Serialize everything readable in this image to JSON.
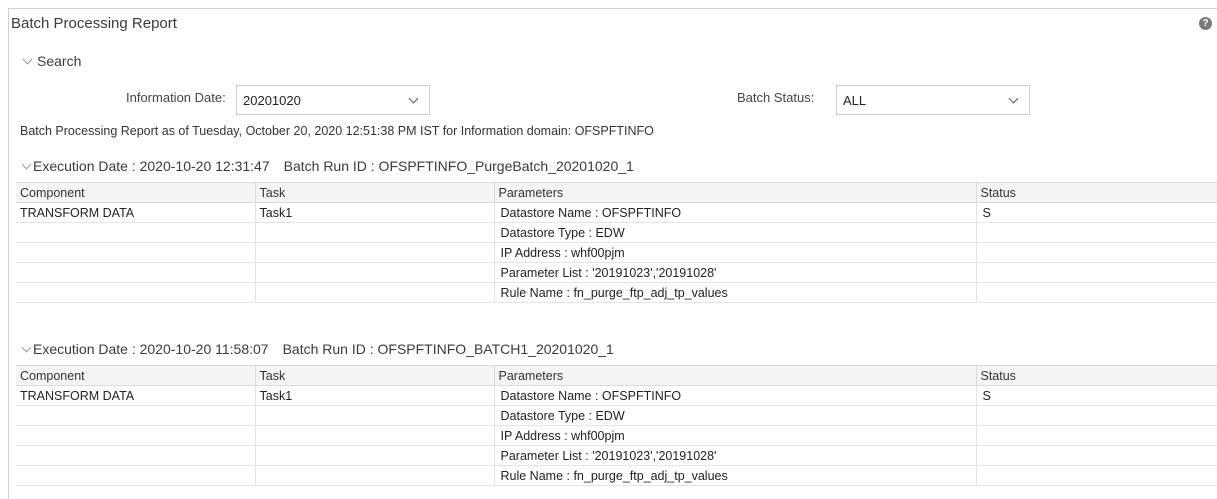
{
  "page": {
    "title": "Batch Processing Report",
    "help_icon": "?"
  },
  "search": {
    "label": "Search",
    "info_date_label": "Information Date:",
    "info_date_value": "20201020",
    "batch_status_label": "Batch Status:",
    "batch_status_value": "ALL"
  },
  "report_line": "Batch Processing Report as of Tuesday, October 20, 2020 12:51:38 PM IST for Information domain: OFSPFTINFO",
  "columns": [
    "Component",
    "Task",
    "Parameters",
    "Status"
  ],
  "executions": [
    {
      "execution_date": "Execution Date : 2020-10-20 12:31:47",
      "batch_run_id": "Batch Run ID : OFSPFTINFO_PurgeBatch_20201020_1",
      "rows": [
        {
          "component": "TRANSFORM DATA",
          "task": "Task1",
          "parameter": "Datastore Name : OFSPFTINFO",
          "status": "S"
        },
        {
          "component": "",
          "task": "",
          "parameter": "Datastore Type : EDW",
          "status": ""
        },
        {
          "component": "",
          "task": "",
          "parameter": "IP Address : whf00pjm",
          "status": ""
        },
        {
          "component": "",
          "task": "",
          "parameter": "Parameter List : '20191023','20191028'",
          "status": ""
        },
        {
          "component": "",
          "task": "",
          "parameter": "Rule Name : fn_purge_ftp_adj_tp_values",
          "status": ""
        }
      ]
    },
    {
      "execution_date": "Execution Date : 2020-10-20 11:58:07",
      "batch_run_id": "Batch Run ID : OFSPFTINFO_BATCH1_20201020_1",
      "rows": [
        {
          "component": "TRANSFORM DATA",
          "task": "Task1",
          "parameter": "Datastore Name : OFSPFTINFO",
          "status": "S"
        },
        {
          "component": "",
          "task": "",
          "parameter": "Datastore Type : EDW",
          "status": ""
        },
        {
          "component": "",
          "task": "",
          "parameter": "IP Address : whf00pjm",
          "status": ""
        },
        {
          "component": "",
          "task": "",
          "parameter": "Parameter List : '20191023','20191028'",
          "status": ""
        },
        {
          "component": "",
          "task": "",
          "parameter": "Rule Name : fn_purge_ftp_adj_tp_values",
          "status": ""
        }
      ]
    }
  ]
}
